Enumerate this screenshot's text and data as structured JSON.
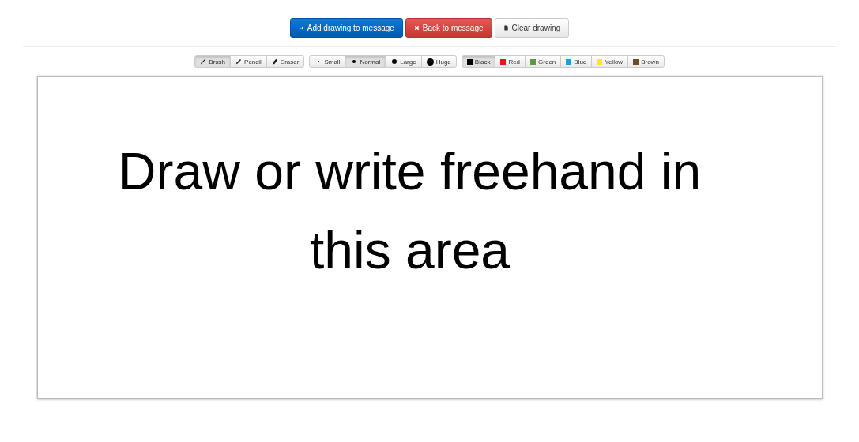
{
  "actions": [
    {
      "kind": "primary",
      "label": "Add drawing to message"
    },
    {
      "kind": "danger",
      "label": "Back to message"
    },
    {
      "kind": "default",
      "label": "Clear drawing"
    }
  ],
  "tools": [
    {
      "label": "Brush",
      "selected": true
    },
    {
      "label": "Pencil",
      "selected": false
    },
    {
      "label": "Eraser",
      "selected": false
    }
  ],
  "sizes": [
    {
      "label": "Small",
      "selected": false
    },
    {
      "label": "Normal",
      "selected": true
    },
    {
      "label": "Large",
      "selected": false
    },
    {
      "label": "Huge",
      "selected": false
    }
  ],
  "colors": [
    {
      "label": "Black",
      "color": "#000000",
      "selected": true
    },
    {
      "label": "Red",
      "color": "#e8141b",
      "selected": false
    },
    {
      "label": "Green",
      "color": "#5a9a3c",
      "selected": false
    },
    {
      "label": "Blue",
      "color": "#1aa0e6",
      "selected": false
    },
    {
      "label": "Yellow",
      "color": "#ffee00",
      "selected": false
    },
    {
      "label": "Brown",
      "color": "#6b4c2a",
      "selected": false
    }
  ],
  "canvas": {
    "handwriting": "Draw or write freehand in this area"
  }
}
